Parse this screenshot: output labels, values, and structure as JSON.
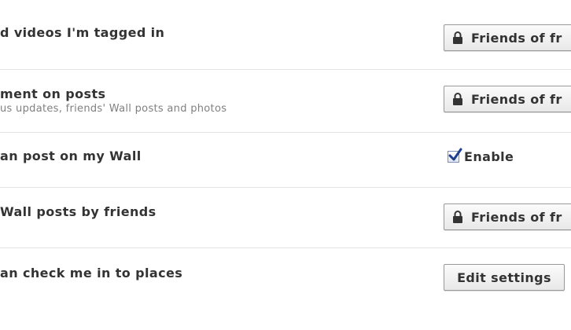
{
  "rows": [
    {
      "title": "d videos I'm tagged in",
      "control": {
        "type": "privacy",
        "label": "Friends of fr",
        "icon": "lock-icon"
      }
    },
    {
      "title": "ment on posts",
      "subtitle": "us updates, friends' Wall posts and photos",
      "control": {
        "type": "privacy",
        "label": "Friends of fr",
        "icon": "lock-icon"
      }
    },
    {
      "title": "an post on my Wall",
      "control": {
        "type": "checkbox",
        "label": "Enable",
        "checked": true
      }
    },
    {
      "title": "Wall posts by friends",
      "control": {
        "type": "privacy",
        "label": "Friends of fr",
        "icon": "lock-icon"
      }
    },
    {
      "title": "an check me in to places",
      "control": {
        "type": "button",
        "label": "Edit settings"
      }
    }
  ],
  "colors": {
    "text": "#333333",
    "subtext": "#808080",
    "divider": "#e3e3e3",
    "checkmark": "#1e3f8f"
  }
}
